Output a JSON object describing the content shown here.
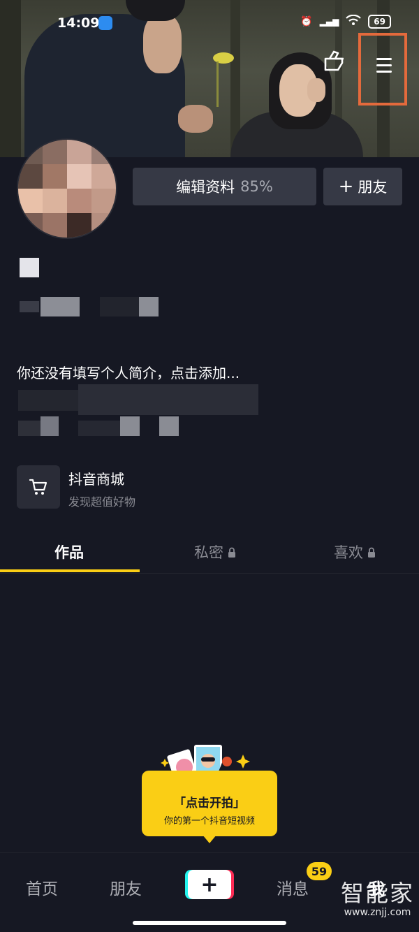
{
  "status_bar": {
    "time": "14:09",
    "battery": "69"
  },
  "profile": {
    "edit_label": "编辑资料",
    "edit_percent": "85%",
    "add_friend_label": "朋友",
    "bio_placeholder": "你还没有填写个人简介，点击添加..."
  },
  "shop": {
    "title": "抖音商城",
    "subtitle": "发现超值好物"
  },
  "tabs": [
    {
      "label": "作品",
      "active": true
    },
    {
      "label": "私密",
      "locked": true
    },
    {
      "label": "喜欢",
      "locked": true
    }
  ],
  "shoot_tip": {
    "title": "「点击开拍」",
    "subtitle": "你的第一个抖音短视频"
  },
  "nav": {
    "home": "首页",
    "friends": "朋友",
    "messages": "消息",
    "messages_badge": "59",
    "me": "我"
  },
  "watermark": {
    "name": "智能家",
    "url": "www.znjj.com"
  },
  "colors": {
    "accent": "#face15",
    "background": "#161823",
    "highlight_box": "#e46a3c"
  }
}
